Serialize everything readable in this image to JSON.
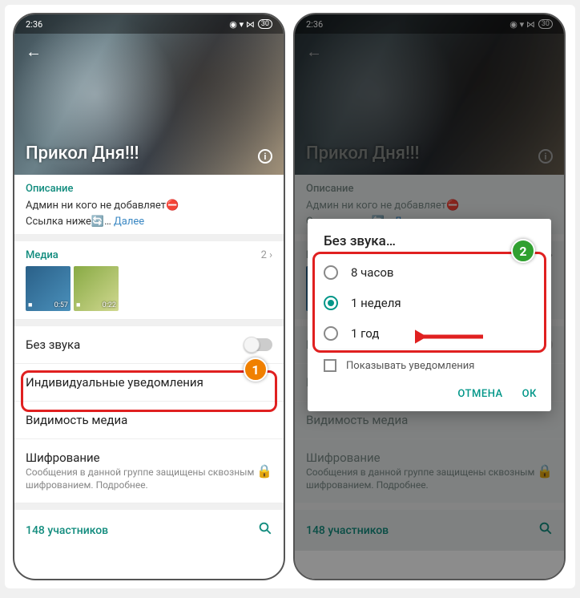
{
  "statusbar": {
    "time": "2:36",
    "battery": "30"
  },
  "header": {
    "group_title": "Прикол Дня!!!"
  },
  "description": {
    "title": "Описание",
    "line1": "Админ ни кого не добавляет⛔",
    "line2_a": "Ссылка ниже🔄… ",
    "line2_link": "Далее"
  },
  "media": {
    "title": "Медиа",
    "count": "2 ›",
    "thumb1_dur": "0:57",
    "thumb2_dur": "0:22"
  },
  "rows": {
    "mute": "Без звука",
    "custom_notif": "Индивидуальные уведомления",
    "media_vis": "Видимость медиа",
    "encryption": "Шифрование",
    "encryption_sub": "Сообщения в данной группе защищены сквозным шифрованием. Подробнее."
  },
  "participants": {
    "label": "148 участников"
  },
  "dialog": {
    "title": "Без звука…",
    "opt1": "8 часов",
    "opt2": "1 неделя",
    "opt3": "1 год",
    "show_notif": "Показывать уведомления",
    "cancel": "ОТМЕНА",
    "ok": "ОК"
  },
  "badges": {
    "one": "1",
    "two": "2"
  }
}
